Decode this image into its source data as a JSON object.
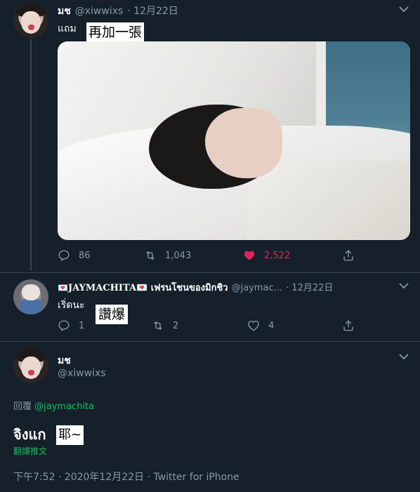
{
  "tweet1": {
    "name": "มช",
    "handle": "@xiwwixs",
    "date": "· 12月22日",
    "text": "แถม",
    "overlay_label": "再加一張",
    "replies": "86",
    "retweets": "1,043",
    "likes": "2,522"
  },
  "tweet2": {
    "name_prefix": "💌",
    "name_main": "JAYMACHITA",
    "name_suffix": "💌 เฟรนโชนของมิกชิว",
    "handle": "@jaymac...",
    "date": "· 12月22日",
    "text": "เริ่ดนะ",
    "overlay_label": "讚爆",
    "replies": "1",
    "retweets": "2",
    "likes": "4"
  },
  "tweet3": {
    "name": "มช",
    "handle": "@xiwwixs",
    "reply_prefix": "回覆",
    "reply_to": "@jaymachita",
    "text": "จิงแก",
    "overlay_label": "耶~",
    "translate": "翻譯推文",
    "meta": "下午7:52 · 2020年12月22日 · Twitter for iPhone"
  },
  "colors": {
    "background": "#15202b",
    "muted": "#8899a6",
    "like": "#e0245e",
    "link_green": "#17bf63",
    "divider": "#38444d"
  },
  "icons": [
    "chevron-down-icon",
    "reply-icon",
    "retweet-icon",
    "heart-icon",
    "share-icon"
  ]
}
